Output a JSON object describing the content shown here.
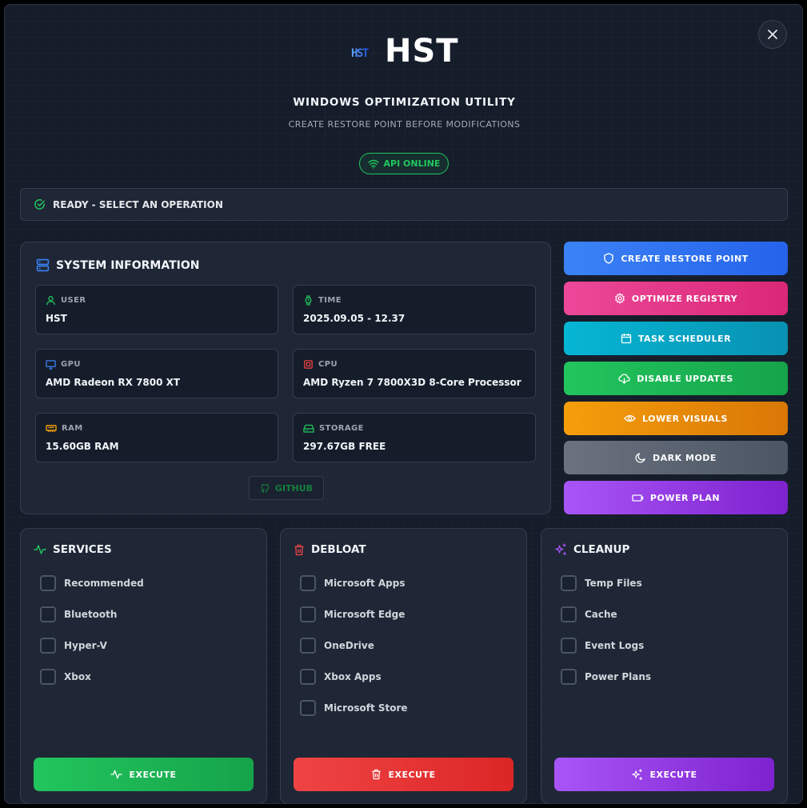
{
  "header": {
    "logo_text": "HST",
    "logo_mark_text": "HST",
    "title": "WINDOWS OPTIMIZATION UTILITY",
    "subtitle": "CREATE RESTORE POINT BEFORE MODIFICATIONS",
    "api_status": "API ONLINE",
    "close_icon": "close-icon"
  },
  "status": {
    "text": "READY - SELECT AN OPERATION",
    "icon": "check-circle-icon"
  },
  "system_info": {
    "title": "SYSTEM INFORMATION",
    "cards": [
      {
        "label": "USER",
        "value": "HST",
        "icon": "user-icon"
      },
      {
        "label": "TIME",
        "value": "2025.09.05 - 12.37",
        "icon": "watch-icon"
      },
      {
        "label": "GPU",
        "value": "AMD Radeon RX 7800 XT",
        "icon": "monitor-icon"
      },
      {
        "label": "CPU",
        "value": "AMD Ryzen 7 7800X3D 8-Core Processor",
        "icon": "cpu-icon"
      },
      {
        "label": "RAM",
        "value": "15.60GB RAM",
        "icon": "memory-icon"
      },
      {
        "label": "STORAGE",
        "value": "297.67GB FREE",
        "icon": "hard-drive-icon"
      }
    ],
    "github_label": "GITHUB"
  },
  "actions": [
    {
      "label": "CREATE RESTORE POINT",
      "icon": "shield-icon",
      "color": "#3b82f6"
    },
    {
      "label": "OPTIMIZE REGISTRY",
      "icon": "gear-icon",
      "color": "#ec4899"
    },
    {
      "label": "TASK SCHEDULER",
      "icon": "calendar-icon",
      "color": "#06b6d4"
    },
    {
      "label": "DISABLE UPDATES",
      "icon": "cloud-download-icon",
      "color": "#22c55e"
    },
    {
      "label": "LOWER VISUALS",
      "icon": "eye-icon",
      "color": "#f59e0b"
    },
    {
      "label": "DARK MODE",
      "icon": "moon-icon",
      "color": "#6b7280"
    },
    {
      "label": "POWER PLAN",
      "icon": "battery-icon",
      "color": "#a855f7"
    }
  ],
  "panels": {
    "services": {
      "title": "SERVICES",
      "icon": "activity-icon",
      "options": [
        "Recommended",
        "Bluetooth",
        "Hyper-V",
        "Xbox"
      ],
      "execute_label": "EXECUTE",
      "color": "#22c55e"
    },
    "debloat": {
      "title": "DEBLOAT",
      "icon": "trash-icon",
      "options": [
        "Microsoft Apps",
        "Microsoft Edge",
        "OneDrive",
        "Xbox Apps",
        "Microsoft Store"
      ],
      "execute_label": "EXECUTE",
      "color": "#ef4444"
    },
    "cleanup": {
      "title": "CLEANUP",
      "icon": "sparkles-icon",
      "options": [
        "Temp Files",
        "Cache",
        "Event Logs",
        "Power Plans"
      ],
      "execute_label": "EXECUTE",
      "color": "#a855f7"
    }
  }
}
